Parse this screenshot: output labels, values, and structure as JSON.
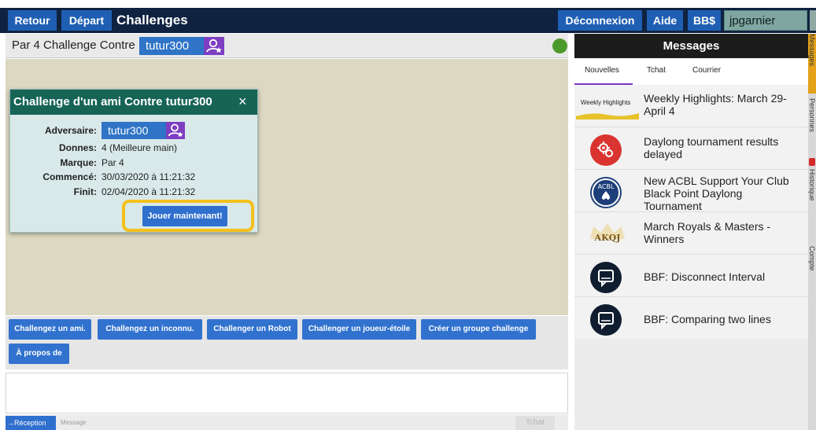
{
  "topbar": {
    "back_label": "Retour",
    "home_label": "Départ",
    "title": "Challenges",
    "logout_label": "Déconnexion",
    "help_label": "Aide",
    "bb_label": "BB$",
    "username": "jpgarnier"
  },
  "table": {
    "title": "Par 4 Challenge Contre",
    "opponent": "tutur300"
  },
  "dialog": {
    "title": "Challenge d'un ami Contre tutur300",
    "close": "×",
    "opponent_label": "Adversaire:",
    "opponent": "tutur300",
    "deals_label": "Donnes:",
    "deals_value": "4 (Meilleure main)",
    "scoring_label": "Marque:",
    "scoring_value": "Par 4",
    "started_label": "Commencé:",
    "started_value": "30/03/2020 à 11:21:32",
    "ends_label": "Finit:",
    "ends_value": "02/04/2020 à 11:21:32",
    "play_label": "Jouer maintenant!"
  },
  "buttons": [
    "Challengez un ami.",
    "Challengez un inconnu.",
    "Challenger un Robot",
    "Challenger un joueur-étoile",
    "Créer un groupe challenge",
    "À propos de"
  ],
  "chat": {
    "reception_label": "→Réception",
    "message_placeholder": "Message",
    "send_label": "Tchat"
  },
  "messages": {
    "header": "Messages",
    "tabs": [
      "Nouvelles",
      "Tchat",
      "Courrier"
    ],
    "news": [
      {
        "thumb": "Weekly Highlights",
        "text": "Weekly Highlights: March 29-April 4",
        "icon": "weekly-highlights-banner"
      },
      {
        "thumb": "",
        "text": "Daylong tournament results delayed",
        "icon": "gear-badge-icon"
      },
      {
        "thumb": "ACBL",
        "text": "New ACBL Support Your Club Black Point Daylong Tournament",
        "icon": "acbl-logo"
      },
      {
        "thumb": "AKQJ",
        "text": "March Royals & Masters - Winners",
        "icon": "akqj-crown-logo"
      },
      {
        "thumb": "",
        "text": "BBF: Disconnect Interval",
        "icon": "chat-bubble-icon"
      },
      {
        "thumb": "",
        "text": "BBF: Comparing two lines",
        "icon": "chat-bubble-icon"
      }
    ]
  },
  "side_tabs": [
    "Messages",
    "Personnes",
    "Historique",
    "Compte"
  ],
  "colors": {
    "topbar": "#0f2240",
    "button_blue": "#3172cf",
    "dialog_header": "#176457",
    "highlight": "#f3c11c",
    "status_online": "#4c9a2a",
    "felt": "#dcd8c1"
  }
}
